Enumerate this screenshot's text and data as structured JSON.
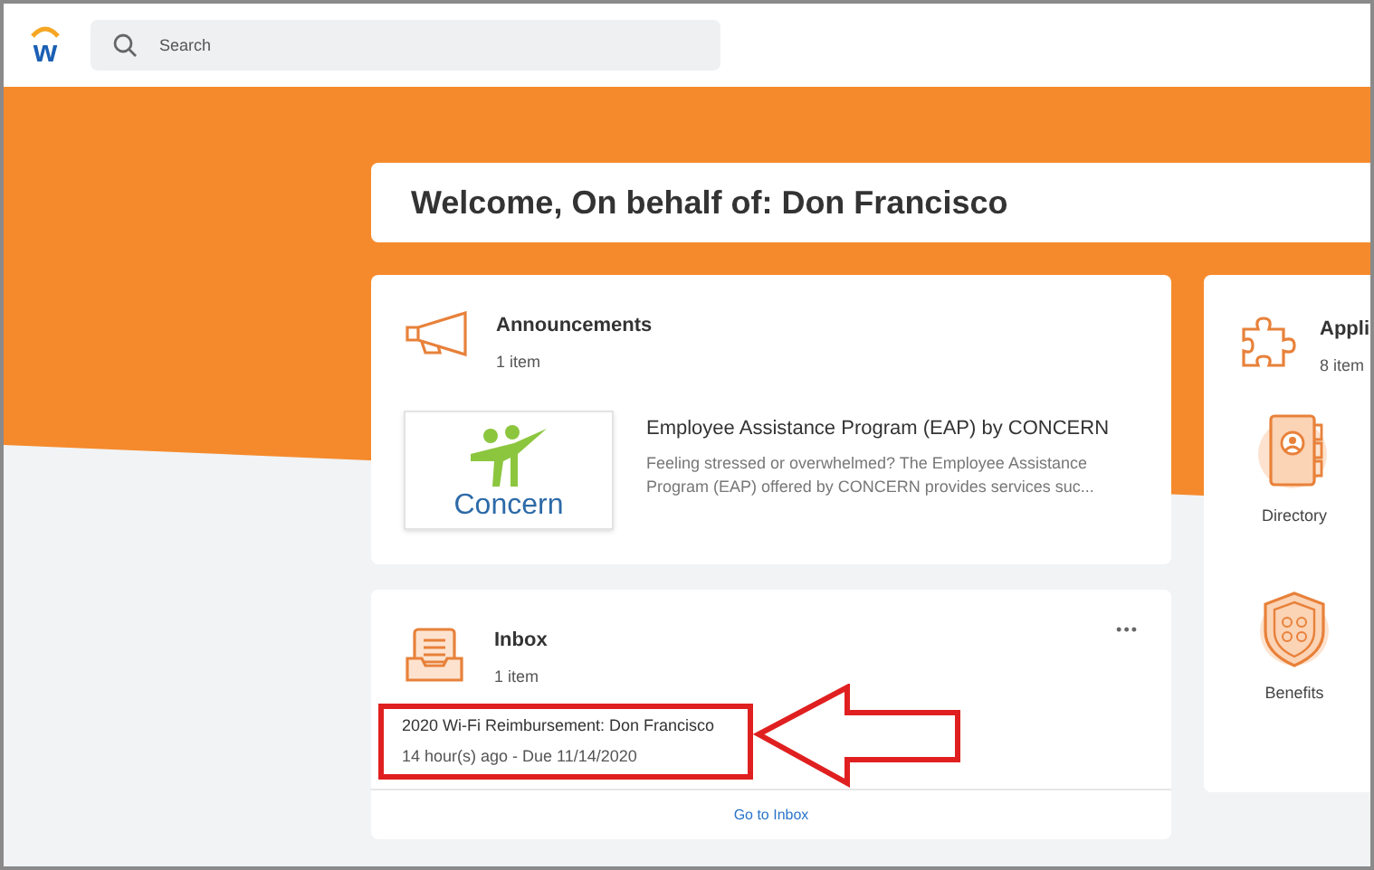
{
  "header": {
    "logo": "w",
    "search": {
      "placeholder": "Search"
    }
  },
  "welcome": {
    "title": "Welcome, On behalf of: Don Francisco"
  },
  "announcements": {
    "title": "Announcements",
    "count": "1 item",
    "items": [
      {
        "logo_text": "Concern",
        "title": "Employee Assistance Program (EAP) by CONCERN",
        "description": "Feeling stressed or overwhelmed? The Employee Assistance Program (EAP) offered by CONCERN provides services suc..."
      }
    ]
  },
  "inbox": {
    "title": "Inbox",
    "count": "1 item",
    "menu": "•••",
    "items": [
      {
        "title": "2020 Wi-Fi Reimbursement: Don Francisco",
        "subtitle": "14 hour(s) ago - Due 11/14/2020",
        "highlighted": true
      }
    ],
    "link": "Go to Inbox"
  },
  "applications": {
    "title": "Appli",
    "count": "8 item",
    "apps": [
      {
        "kind": "directory",
        "label": "Directory"
      },
      {
        "kind": "benefits",
        "label": "Benefits"
      }
    ]
  }
}
